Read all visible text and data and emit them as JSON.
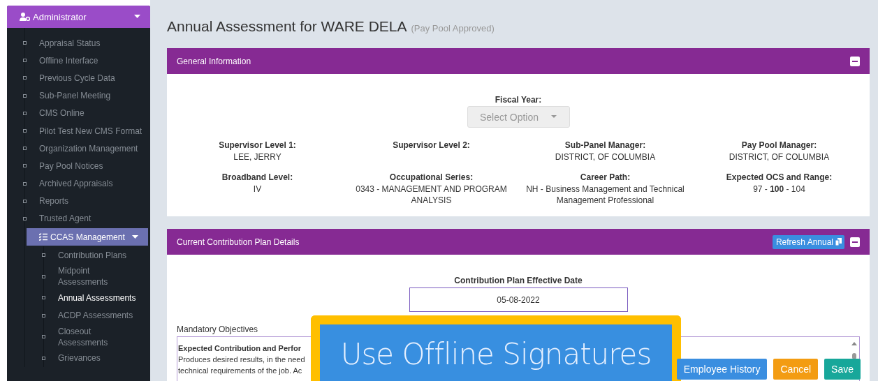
{
  "sidebar": {
    "header": {
      "label": "Administrator",
      "expanded": true
    },
    "items": [
      {
        "kind": "link",
        "label": "Appraisal Status"
      },
      {
        "kind": "link",
        "label": "Offline Interface"
      },
      {
        "kind": "link",
        "label": "Previous Cycle Data"
      },
      {
        "kind": "link",
        "label": "Sub-Panel Meeting"
      },
      {
        "kind": "link",
        "label": "CMS Online"
      },
      {
        "kind": "link",
        "label": "Pilot Test New CMS Format"
      },
      {
        "kind": "link",
        "label": "Organization Management"
      },
      {
        "kind": "link",
        "label": "Pay Pool Notices"
      },
      {
        "kind": "link",
        "label": "Archived Appraisals"
      },
      {
        "kind": "link",
        "label": "Reports"
      },
      {
        "kind": "link",
        "label": "Trusted Agent"
      },
      {
        "kind": "group",
        "label": "CCAS Management",
        "expanded": true,
        "children": [
          {
            "label": "Contribution Plans",
            "selected": false
          },
          {
            "label": "Midpoint Assessments",
            "selected": false
          },
          {
            "label": "Annual Assessments",
            "selected": true
          },
          {
            "label": "ACDP Assessments",
            "selected": false
          },
          {
            "label": "Closeout Assessments",
            "selected": false
          },
          {
            "label": "Grievances",
            "selected": false
          }
        ]
      }
    ]
  },
  "page": {
    "title": "Annual Assessment for WARE DELA",
    "status": "(Pay Pool Approved)"
  },
  "general_panel": {
    "title": "General Information",
    "fiscal_year": {
      "label": "Fiscal Year:",
      "placeholder": "Select Option",
      "disabled": true
    },
    "fields": [
      {
        "label": "Supervisor Level 1:",
        "value": "LEE, JERRY"
      },
      {
        "label": "Supervisor Level 2:"
      },
      {
        "label": "Sub-Panel Manager:",
        "value": "DISTRICT, OF COLUMBIA"
      },
      {
        "label": "Pay Pool Manager:",
        "value": "DISTRICT, OF COLUMBIA"
      },
      {
        "label": "Broadband Level:",
        "value": "IV"
      },
      {
        "label": "Occupational Series:",
        "value": "0343 - MANAGEMENT AND PROGRAM ANALYSIS"
      },
      {
        "label": "Career Path:",
        "value": "NH - Business Management and Technical Management Professional"
      },
      {
        "label": "Expected OCS and Range:",
        "value": "97 - **100** - 104"
      }
    ]
  },
  "plan_panel": {
    "title": "Current Contribution Plan Details",
    "refresh_button": "Refresh Annual",
    "effective_date": {
      "label": "Contribution Plan Effective Date",
      "value": "05-08-2022"
    },
    "objectives": {
      "label": "Mandatory Objectives",
      "heading": "Expected Contribution and Perfor",
      "lines": [
        "Produces desired results, in the need",
        "technical requirements of the job. Ac"
      ]
    }
  },
  "overlay": {
    "label": "Use Offline Signatures"
  },
  "actions": [
    {
      "kind": "info",
      "label": "Employee History"
    },
    {
      "kind": "warning",
      "label": "Cancel"
    },
    {
      "kind": "success",
      "label": "Save"
    }
  ]
}
